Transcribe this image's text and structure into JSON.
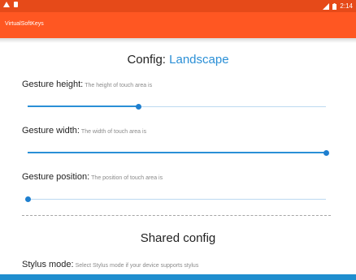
{
  "status_bar": {
    "time": "2:14",
    "icons": [
      "warning-icon",
      "sd-card-icon",
      "signal-icon",
      "battery-icon"
    ]
  },
  "app_bar": {
    "title": "VirtualSoftKeys"
  },
  "config_section": {
    "heading_prefix": "Config: ",
    "heading_mode": "Landscape",
    "settings": [
      {
        "label": "Gesture height:",
        "description": "The height of touch area is",
        "value_fraction": 0.37
      },
      {
        "label": "Gesture width:",
        "description": "The width of touch area is",
        "value_fraction": 1.0
      },
      {
        "label": "Gesture position:",
        "description": "The position of touch area is",
        "value_fraction": 0.0
      }
    ]
  },
  "shared_section": {
    "heading": "Shared config",
    "stylus_label": "Stylus mode:",
    "stylus_description": "Select Stylus mode if your device supports stylus"
  },
  "colors": {
    "status_bar": "#e64a19",
    "app_bar": "#ff5722",
    "accent": "#2a8fd6"
  }
}
